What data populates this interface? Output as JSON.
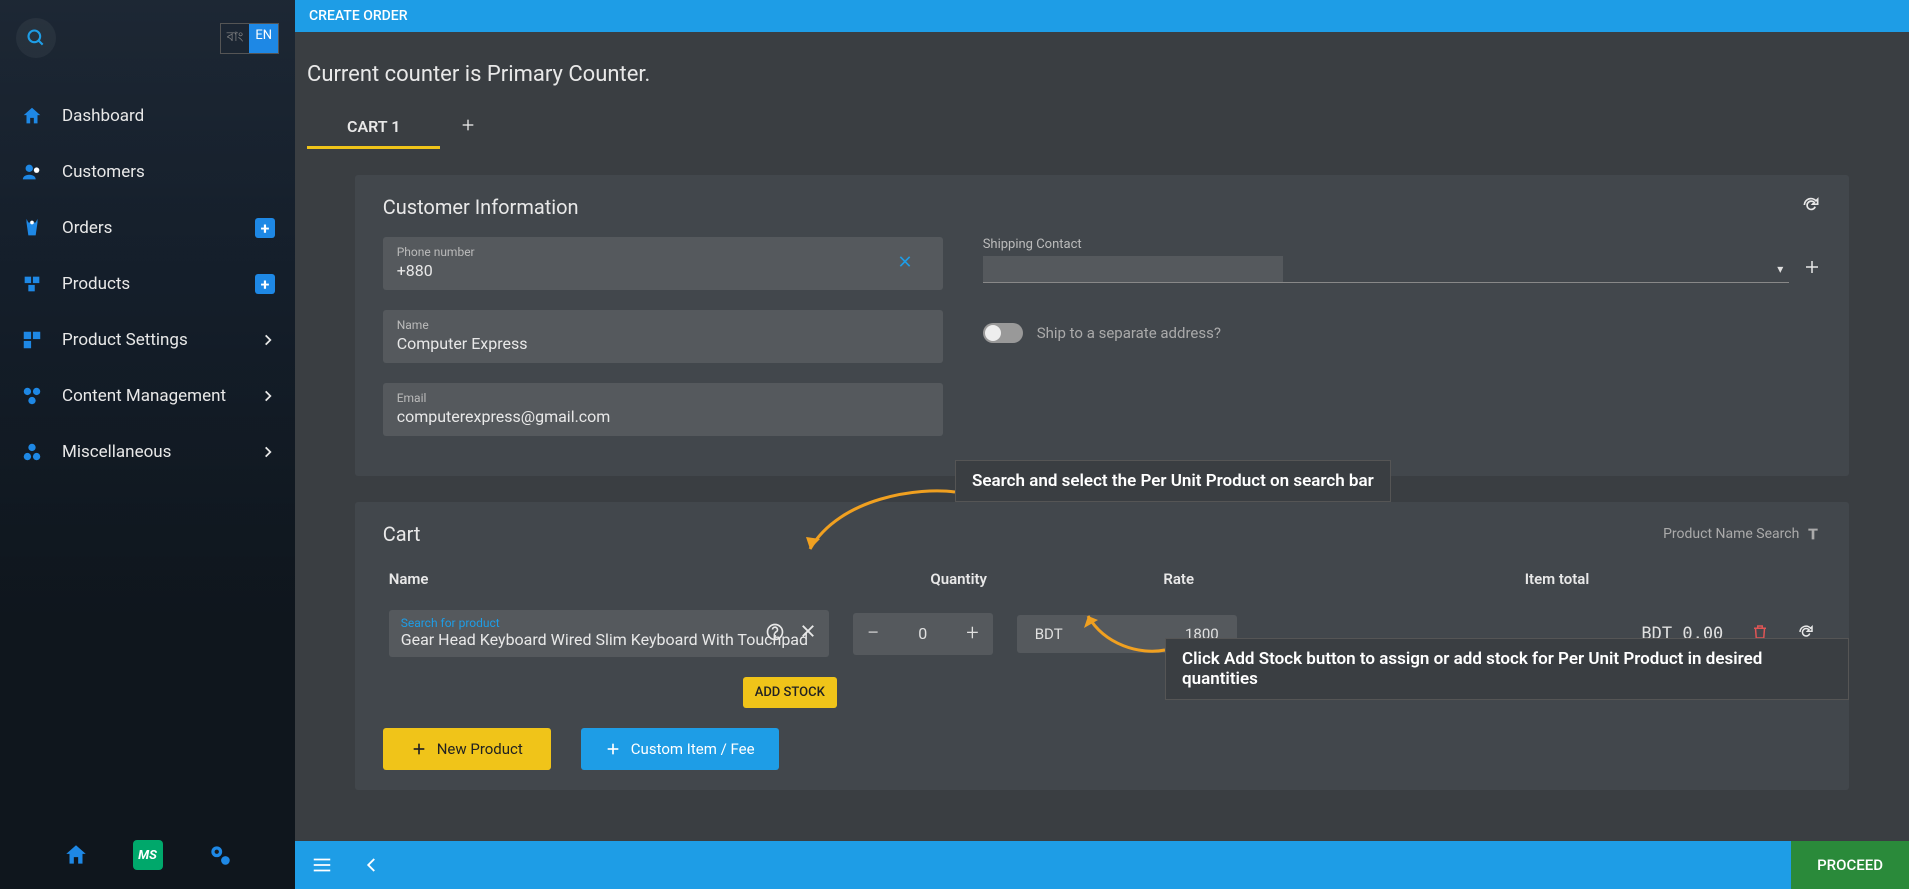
{
  "lang": {
    "opt1": "বাং",
    "opt2": "EN"
  },
  "sidebar": {
    "items": [
      {
        "label": "Dashboard"
      },
      {
        "label": "Customers"
      },
      {
        "label": "Orders"
      },
      {
        "label": "Products"
      },
      {
        "label": "Product Settings"
      },
      {
        "label": "Content Management"
      },
      {
        "label": "Miscellaneous"
      }
    ],
    "ms_badge": "MS"
  },
  "topbar": {
    "title": "CREATE ORDER"
  },
  "counter_text": "Current counter is Primary Counter.",
  "tabs": {
    "tab1": "CART 1"
  },
  "customer": {
    "section_title": "Customer Information",
    "phone_label": "Phone number",
    "phone_value": "+880",
    "name_label": "Name",
    "name_value": "Computer Express",
    "email_label": "Email",
    "email_value": "computerexpress@gmail.com",
    "shipping_label": "Shipping Contact",
    "ship_toggle_label": "Ship to a separate address?"
  },
  "cart": {
    "section_title": "Cart",
    "search_mode": "Product Name Search",
    "cols": {
      "name": "Name",
      "qty": "Quantity",
      "rate": "Rate",
      "total": "Item total"
    },
    "row": {
      "search_label": "Search for product",
      "product_name": "Gear Head Keyboard Wired Slim Keyboard With Touchpad",
      "qty": "0",
      "currency": "BDT",
      "rate": "1800",
      "total": "BDT 0.00"
    },
    "add_stock": "ADD STOCK",
    "new_product": "New Product",
    "custom_item": "Custom Item / Fee"
  },
  "callouts": {
    "c1": "Search and select the Per Unit Product on search bar",
    "c2": "Click Add Stock button to assign or add stock for Per Unit Product in desired quantities"
  },
  "bottombar": {
    "proceed": "PROCEED"
  },
  "colors": {
    "accent": "#1e9de6",
    "warning": "#f0c419",
    "success": "#2a8a3a",
    "danger": "#e05555"
  }
}
